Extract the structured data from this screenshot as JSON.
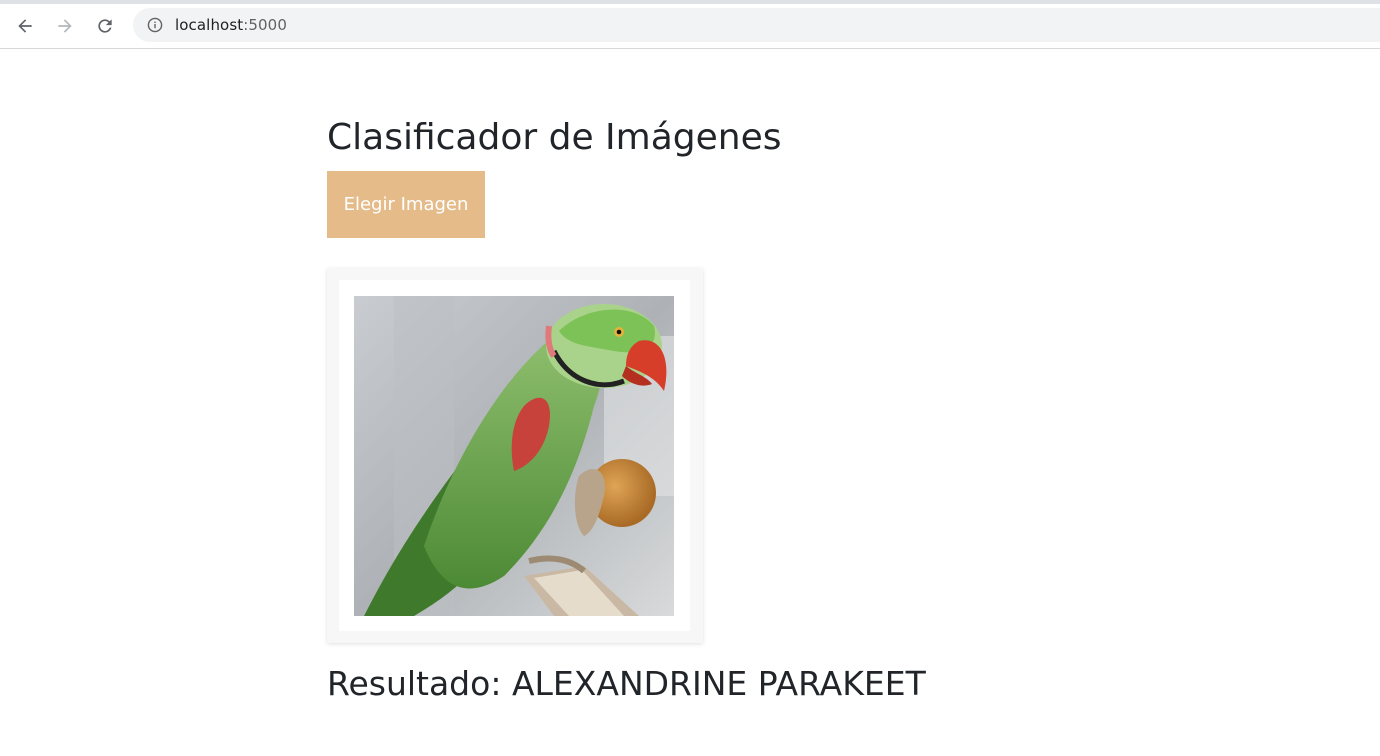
{
  "browser": {
    "url": "localhost",
    "url_port": ":5000",
    "icons": {
      "back": "back-arrow-icon",
      "forward": "forward-arrow-icon",
      "reload": "reload-icon",
      "site_info": "info-icon"
    }
  },
  "page": {
    "title": "Clasificador de Imágenes",
    "choose_button_label": "Elegir Imagen",
    "result_label": "Resultado:",
    "result_value": "ALEXANDRINE PARAKEET"
  },
  "colors": {
    "button_bg": "#e5bb8a",
    "button_text": "#ffffff",
    "text": "#212529"
  }
}
